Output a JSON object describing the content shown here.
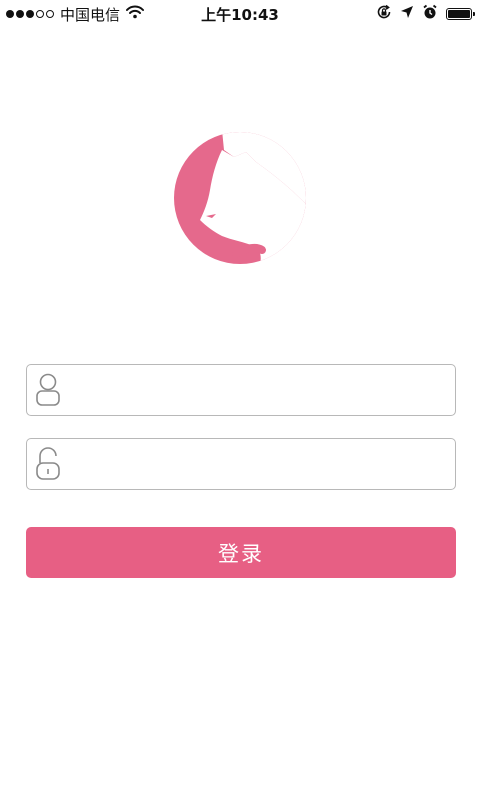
{
  "status_bar": {
    "signal": {
      "filled": 3,
      "total": 5
    },
    "carrier": "中国电信",
    "time": "上午10:43",
    "battery_level": 1.0,
    "icons": [
      "wifi-icon",
      "rotation-lock-icon",
      "location-arrow-icon",
      "alarm-icon",
      "battery-icon"
    ]
  },
  "logo": {
    "icon": "cat-head-logo",
    "color": "#e5698c"
  },
  "login_form": {
    "username": {
      "icon": "user-icon",
      "value": "",
      "placeholder": ""
    },
    "password": {
      "icon": "lock-icon",
      "value": "",
      "placeholder": ""
    },
    "submit_label": "登录"
  },
  "colors": {
    "accent": "#e75f84",
    "field_border": "#b8b8b8",
    "icon_gray": "#8a8a8a"
  }
}
